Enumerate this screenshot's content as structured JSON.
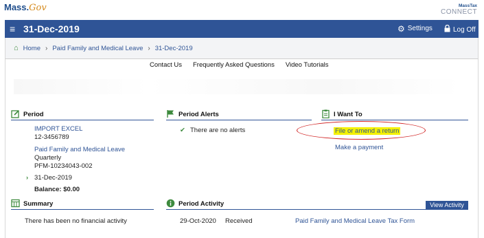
{
  "brand": {
    "mass": "Mass.",
    "gov": "Gov",
    "mtc_line1": "MassTax",
    "mtc_line2": "CONNECT"
  },
  "header": {
    "title": "31-Dec-2019",
    "settings": "Settings",
    "logoff": "Log Off"
  },
  "breadcrumb": {
    "items": [
      "Home",
      "Paid Family and Medical Leave",
      "31-Dec-2019"
    ],
    "separator": "›"
  },
  "linkbar": {
    "items": [
      "Contact Us",
      "Frequently Asked Questions",
      "Video Tutorials"
    ]
  },
  "period": {
    "heading": "Period",
    "account_name": "IMPORT EXCEL",
    "account_id": "12-3456789",
    "account_type": "Paid Family and Medical Leave",
    "frequency": "Quarterly",
    "account_number": "PFM-10234043-002",
    "period_date": "31-Dec-2019",
    "balance": "Balance: $0.00"
  },
  "alerts": {
    "heading": "Period Alerts",
    "message": "There are no alerts"
  },
  "iwantto": {
    "heading": "I Want To",
    "file_return": "File or amend a return",
    "make_payment": "Make a payment"
  },
  "summary": {
    "heading": "Summary",
    "message": "There has been no financial activity"
  },
  "activity": {
    "heading": "Period Activity",
    "view_button": "View Activity",
    "rows": [
      {
        "date": "29-Oct-2020",
        "status": "Received",
        "form": "Paid Family and Medical Leave Tax Form"
      }
    ]
  },
  "colors": {
    "header_bg": "#2f5496",
    "link": "#2f5496",
    "highlight": "#f4f100",
    "annotation": "#d02020",
    "icon_green": "#3d8a3d"
  },
  "icons": {
    "menu": "menu-icon",
    "settings": "gear-icon",
    "logoff": "lock-icon",
    "home": "home-icon",
    "period": "edit-icon",
    "alerts": "flag-icon",
    "iwantto": "clipboard-icon",
    "summary": "ledger-icon",
    "activity": "info-icon"
  }
}
